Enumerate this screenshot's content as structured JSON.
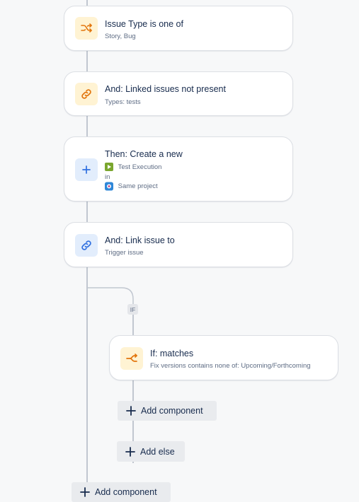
{
  "colors": {
    "orange": "#e2740b",
    "blue": "#2f6fe0",
    "line": "#c1c7d0",
    "green": "#7aa62e"
  },
  "cards": [
    {
      "title": "Issue Type is one of",
      "subtitle": "Story, Bug",
      "icon": "shuffle-icon"
    },
    {
      "title": "And: Linked issues not present",
      "subtitle": "Types: tests",
      "icon": "link-icon"
    },
    {
      "title": "Then: Create a new",
      "issue_type": "Test Execution",
      "in_label": "in",
      "project": "Same project",
      "icon": "plus-icon"
    },
    {
      "title": "And: Link issue to",
      "subtitle": "Trigger issue",
      "icon": "link-icon"
    }
  ],
  "branch": {
    "badge": "IF",
    "condition": {
      "title": "If: matches",
      "subtitle": "Fix versions contains none of: Upcoming/Forthcoming",
      "icon": "branch-icon"
    },
    "add_component": "Add component",
    "add_else": "Add else"
  },
  "footer": {
    "add_component": "Add component"
  }
}
